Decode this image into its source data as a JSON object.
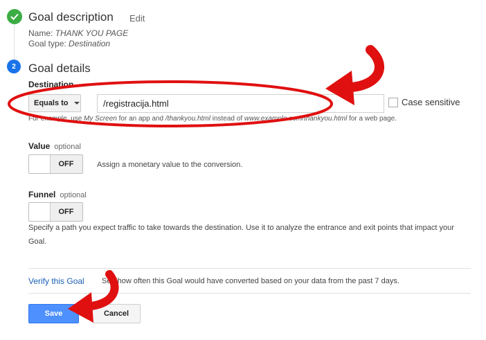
{
  "step1": {
    "title": "Goal description",
    "edit_label": "Edit",
    "name_label": "Name:",
    "name_value": "THANK YOU PAGE",
    "type_label": "Goal type:",
    "type_value": "Destination"
  },
  "step2": {
    "number": "2",
    "title": "Goal details"
  },
  "destination": {
    "label": "Destination",
    "match_type": "Equals to",
    "value": "/registracija.html",
    "case_sensitive_label": "Case sensitive",
    "hint_prefix": "For example, use",
    "hint_em1": "My Screen",
    "hint_mid1": "for an app and",
    "hint_em2": "/thankyou.html",
    "hint_mid2": "instead of",
    "hint_em3": "www.example.com/thankyou.html",
    "hint_suffix": "for a web page."
  },
  "value": {
    "label": "Value",
    "optional": "optional",
    "toggle_text": "OFF",
    "description": "Assign a monetary value to the conversion."
  },
  "funnel": {
    "label": "Funnel",
    "optional": "optional",
    "toggle_text": "OFF",
    "description_line1": "Specify a path you expect traffic to take towards the destination. Use it to analyze the entrance and exit points that impact your",
    "description_line2": "Goal."
  },
  "verify": {
    "link": "Verify this Goal",
    "text": "See how often this Goal would have converted based on your data from the past 7 days."
  },
  "actions": {
    "save": "Save",
    "cancel": "Cancel"
  },
  "colors": {
    "annotation_red": "#e01010",
    "accent_blue": "#4d90fe",
    "step_done_green": "#3cad45"
  }
}
